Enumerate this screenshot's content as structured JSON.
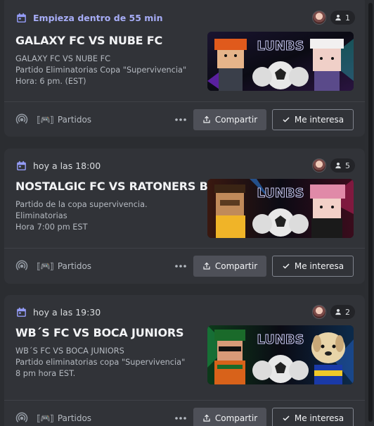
{
  "events": [
    {
      "when": "Empieza dentro de 55 min",
      "attendees": "1",
      "title": "GALAXY FC VS NUBE FC",
      "description": [
        "GALAXY FC VS NUBE FC",
        "Partido Eliminatorias Copa \"Supervivencia\"",
        "Hora: 6 pm. (EST)"
      ],
      "banner_text": "LUNBS",
      "channel_emoji": "⟦🎮⟧",
      "channel": "Partidos",
      "share_label": "Compartir",
      "interest_label": "Me interesa"
    },
    {
      "when": "hoy a las 18:00",
      "attendees": "5",
      "title": "NOSTALGIC FC VS RATONERS BV",
      "description": [
        "Partido de la copa supervivencia.",
        "Eliminatorias",
        "Hora 7:00 pm EST"
      ],
      "banner_text": "LUNBS",
      "channel_emoji": "⟦🎮⟧",
      "channel": "Partidos",
      "share_label": "Compartir",
      "interest_label": "Me interesa"
    },
    {
      "when": "hoy a las 19:30",
      "attendees": "2",
      "title": "WB´S FC VS BOCA JUNIORS",
      "description": [
        "WB´S FC VS BOCA JUNIORS",
        "Partido eliminatorias copa \"Supervivencia\"",
        "8 pm hora EST."
      ],
      "banner_text": "LUNBS",
      "channel_emoji": "⟦🎮⟧",
      "channel": "Partidos",
      "share_label": "Compartir",
      "interest_label": "Me interesa"
    }
  ],
  "colors": {
    "background": "#2b2d31",
    "card": "#313338",
    "soon_accent": "#a7adf7",
    "calendar_icon": "#949cf7",
    "button_secondary": "#4e5058"
  },
  "icons": {
    "calendar": "calendar-icon",
    "attendees": "person-icon",
    "stage": "stage-channel-icon",
    "more": "more-dots-icon",
    "share": "share-icon",
    "interest": "checkmark-icon"
  }
}
